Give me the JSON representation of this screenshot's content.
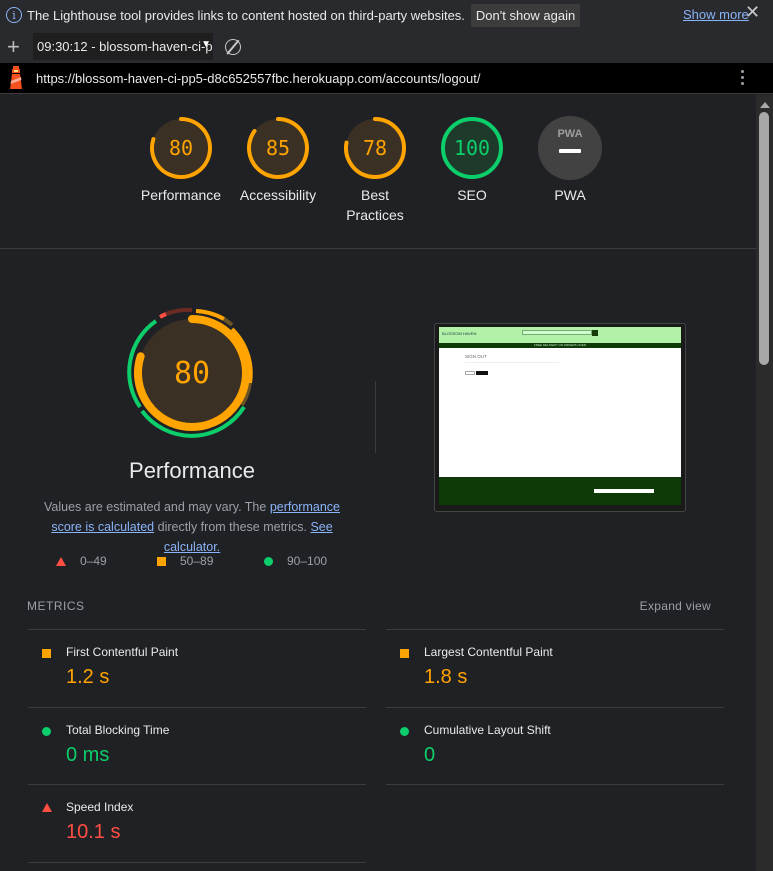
{
  "infobar": {
    "message": "The Lighthouse tool provides links to content hosted on third-party websites.",
    "dont_show_label": "Don't show again",
    "show_more_label": "Show more"
  },
  "toolbar": {
    "report_select": "09:30:12 - blossom-haven-ci-p"
  },
  "urlbar": {
    "url": "https://blossom-haven-ci-pp5-d8c652557fbc.herokuapp.com/accounts/logout/"
  },
  "categories": [
    {
      "label": "Performance",
      "score": "80",
      "fraction": 0.8,
      "rating": "average"
    },
    {
      "label": "Accessibility",
      "score": "85",
      "fraction": 0.85,
      "rating": "average"
    },
    {
      "label": "Best Practices",
      "score": "78",
      "fraction": 0.78,
      "rating": "average"
    },
    {
      "label": "SEO",
      "score": "100",
      "fraction": 1.0,
      "rating": "pass"
    },
    {
      "label": "PWA",
      "score": "PWA",
      "fraction": null,
      "rating": "na"
    }
  ],
  "performance": {
    "score": "80",
    "title": "Performance",
    "desc_prefix": "Values are estimated and may vary. The ",
    "link_score": "performance score is calculated",
    "desc_mid": " directly from these metrics. ",
    "link_calc": "See calculator."
  },
  "legend": {
    "fail": "0–49",
    "average": "50–89",
    "pass": "90–100"
  },
  "screenshot": {
    "logo": "BLOSSOM HAVEN",
    "title": "SIGN OUT",
    "banner": "FREE DELIVERY ON ORDERS OVER"
  },
  "metrics": {
    "heading": "METRICS",
    "expand_label": "Expand view",
    "items": [
      {
        "label": "First Contentful Paint",
        "value": "1.2 s",
        "rating": "average"
      },
      {
        "label": "Largest Contentful Paint",
        "value": "1.8 s",
        "rating": "average"
      },
      {
        "label": "Total Blocking Time",
        "value": "0 ms",
        "rating": "pass"
      },
      {
        "label": "Cumulative Layout Shift",
        "value": "0",
        "rating": "pass"
      },
      {
        "label": "Speed Index",
        "value": "10.1 s",
        "rating": "fail"
      }
    ]
  },
  "colors": {
    "average": "#ffa400",
    "pass": "#0cce6b",
    "fail": "#ff4e42",
    "link": "#8ab4f8"
  }
}
